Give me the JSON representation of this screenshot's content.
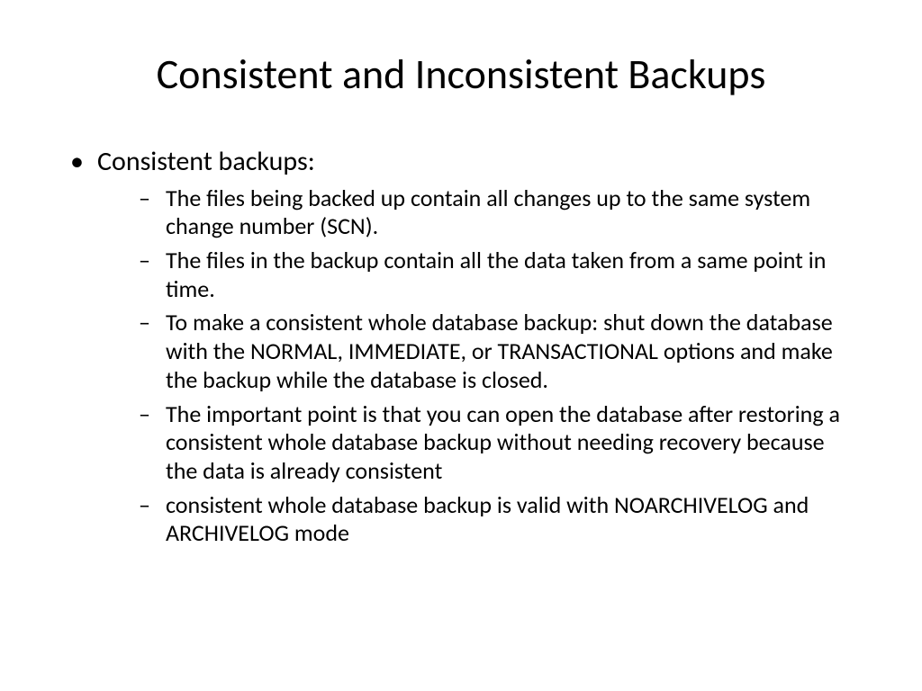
{
  "slide": {
    "title": "Consistent and Inconsistent Backups",
    "bullets": [
      {
        "text": "Consistent backups:",
        "children": [
          "The files being backed up contain all changes up to the same system change number (SCN).",
          "The files in the backup contain all the data taken from a same point in time.",
          "To make a consistent whole database backup: shut down the database with the NORMAL, IMMEDIATE, or TRANSACTIONAL options and make the backup while the database is closed.",
          "The important point is that you can open the database after restoring a consistent whole database backup without needing recovery because the data is already consistent",
          "consistent whole database backup is valid with NOARCHIVELOG and ARCHIVELOG  mode"
        ]
      }
    ]
  }
}
